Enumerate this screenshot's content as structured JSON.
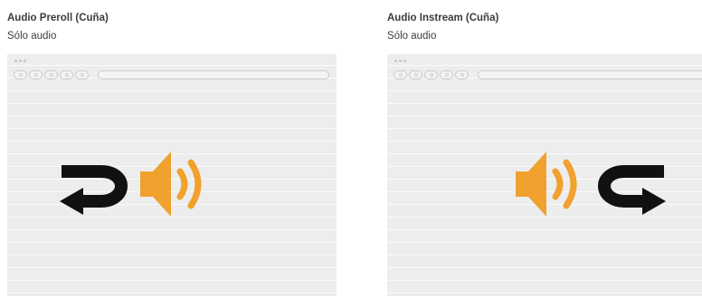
{
  "panels": [
    {
      "title": "Audio Preroll (Cuña)",
      "subtitle": "Sólo audio",
      "arrow_icon": "curved-arrow-left-icon"
    },
    {
      "title": "Audio Instream (Cuña)",
      "subtitle": "Sólo audio",
      "arrow_icon": "curved-arrow-right-icon"
    }
  ],
  "icons": {
    "speaker": "speaker-sound-icon"
  },
  "colors": {
    "speaker": "#f0a12e",
    "arrow": "#111111",
    "text": "#3c3c3c",
    "mock_bg": "#ededed"
  }
}
